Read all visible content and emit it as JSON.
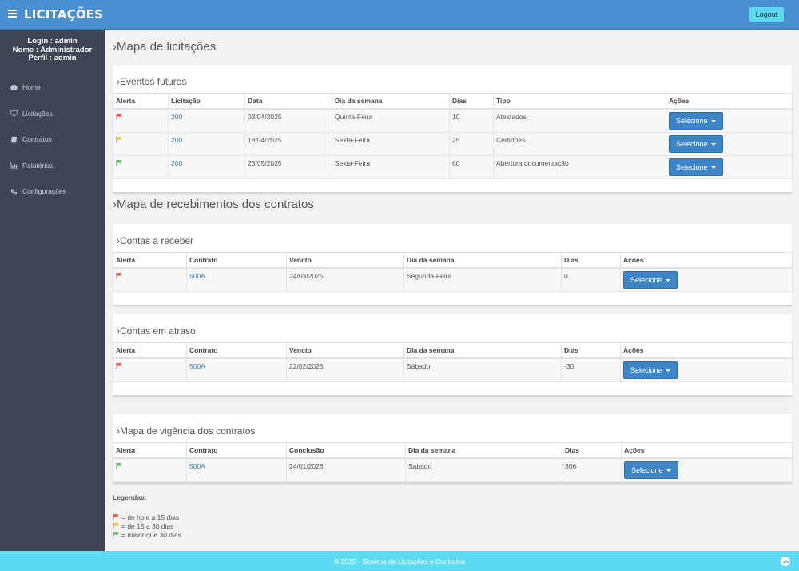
{
  "app": {
    "title": "LICITAÇÕES",
    "logout_label": "Logout"
  },
  "user": {
    "login": "Login : admin",
    "nome": "Nome : Administrador",
    "perfil": "Perfil : admin"
  },
  "sidebar": {
    "items": [
      {
        "label": "Home",
        "icon": "dashboard-icon"
      },
      {
        "label": "Licitações",
        "icon": "monitor-icon"
      },
      {
        "label": "Contratos",
        "icon": "book-icon"
      },
      {
        "label": "Relatórios",
        "icon": "bar-chart-icon"
      },
      {
        "label": "Configurações",
        "icon": "gears-icon"
      }
    ]
  },
  "sections": {
    "licitacoes_title": "›Mapa de licitações",
    "recebimentos_title": "›Mapa de recebimentos dos contratos"
  },
  "eventos": {
    "title": "›Eventos futuros",
    "headers": [
      "Alerta",
      "Licitação",
      "Data",
      "Dia da semana",
      "Dias",
      "Tipo",
      "Ações"
    ],
    "rows": [
      {
        "flag": "red",
        "licitacao": "200",
        "data": "03/04/2025",
        "dia": "Quinta-Feira",
        "dias": "10",
        "tipo": "Atestados",
        "acao": "Selecione"
      },
      {
        "flag": "yellow",
        "licitacao": "200",
        "data": "18/04/2025",
        "dia": "Sexta-Feira",
        "dias": "25",
        "tipo": "Certidões",
        "acao": "Selecione"
      },
      {
        "flag": "green",
        "licitacao": "200",
        "data": "23/05/2025",
        "dia": "Sexta-Feira",
        "dias": "60",
        "tipo": "Abertura documentação",
        "acao": "Selecione"
      }
    ]
  },
  "receber": {
    "title": "›Contas a receber",
    "headers": [
      "Alerta",
      "Contrato",
      "Vencto",
      "Dia da semana",
      "Dias",
      "Ações"
    ],
    "rows": [
      {
        "flag": "red",
        "contrato": "500A",
        "vencto": "24/03/2025",
        "dia": "Segunda-Feira",
        "dias": "0",
        "acao": "Selecione"
      }
    ]
  },
  "atraso": {
    "title": "›Contas em atraso",
    "headers": [
      "Alerta",
      "Contrato",
      "Vencto",
      "Dia da semana",
      "Dias",
      "Ações"
    ],
    "rows": [
      {
        "flag": "red",
        "contrato": "500A",
        "vencto": "22/02/2025",
        "dia": "Sábado",
        "dias": "-30",
        "acao": "Selecione"
      }
    ]
  },
  "vigencia": {
    "title": "›Mapa de vigência dos contratos",
    "headers": [
      "Alerta",
      "Contrato",
      "Conclusão",
      "Dia da semana",
      "Dias",
      "Ações"
    ],
    "rows": [
      {
        "flag": "green",
        "contrato": "500A",
        "conclusao": "24/01/2026",
        "dia": "Sábado",
        "dias": "306",
        "acao": "Selecione"
      }
    ]
  },
  "legend": {
    "title": "Legendas:",
    "items": [
      {
        "flag": "red",
        "text": "= de hoje a 15 dias"
      },
      {
        "flag": "yellow",
        "text": "= de 15 a 30 dias"
      },
      {
        "flag": "green",
        "text": "= maior que 30 dias"
      }
    ]
  },
  "colors": {
    "red": "#e8553c",
    "yellow": "#e8c53c",
    "green": "#5cb85c",
    "header": "#4a8fd0",
    "footer": "#5bdcf2",
    "sidebar": "#3e4554"
  },
  "footer": {
    "text": "© 2025 - Sistema de Licitações e Contratos"
  }
}
